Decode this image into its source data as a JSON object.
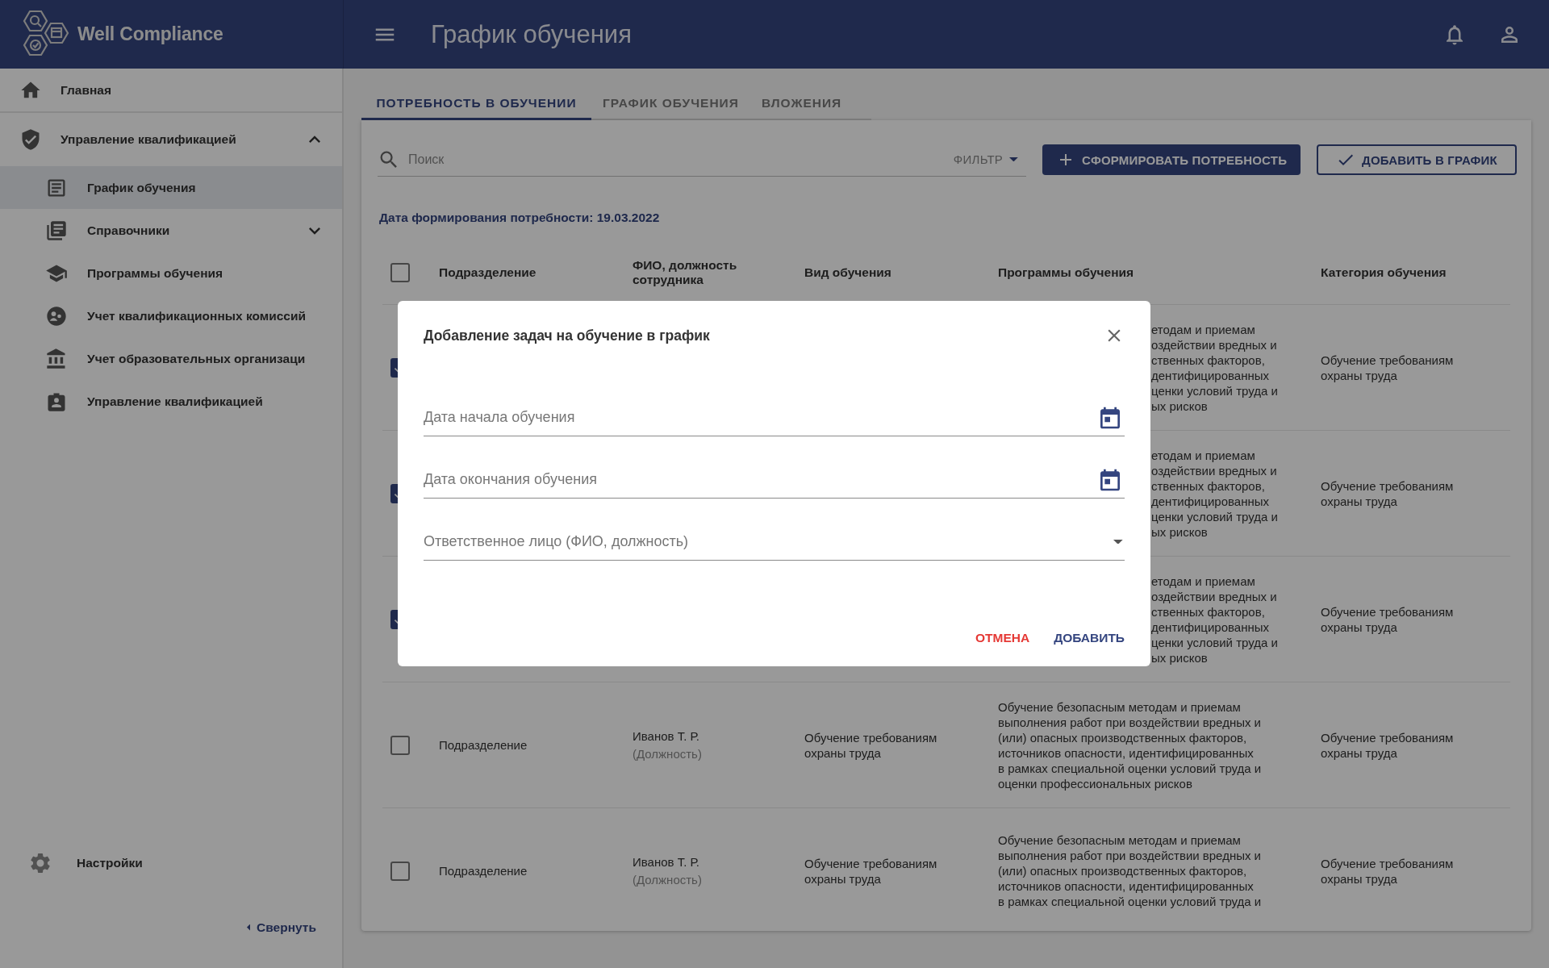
{
  "app": {
    "name": "Well Compliance"
  },
  "header": {
    "title": "График обучения"
  },
  "sidebar": {
    "items": [
      {
        "label": "Главная",
        "selected": false
      },
      {
        "label": "Управление квалификацией",
        "selected": false,
        "expanded": true,
        "children": [
          {
            "label": "График обучения",
            "selected": true
          },
          {
            "label": "Справочники",
            "selected": false,
            "expanded": false
          },
          {
            "label": "Программы обучения",
            "selected": false
          },
          {
            "label": "Учет квалификационных комиссий",
            "selected": false
          },
          {
            "label": "Учет образовательных организаци",
            "selected": false
          },
          {
            "label": "Управление квалификацией",
            "selected": false
          }
        ]
      }
    ],
    "settings": "Настройки",
    "collapse": "Свернуть"
  },
  "tabs": [
    {
      "label": "ПОТРЕБНОСТЬ В ОБУЧЕНИИ",
      "selected": true
    },
    {
      "label": "ГРАФИК ОБУЧЕНИЯ",
      "selected": false
    },
    {
      "label": "ВЛОЖЕНИЯ",
      "selected": false
    }
  ],
  "toolbar": {
    "search": {
      "placeholder": "Поиск"
    },
    "filter": "ФИЛЬТР",
    "buttons": [
      {
        "label": "СФОРМИРОВАТЬ ПОТРЕБНОСТЬ",
        "kind": "primary"
      },
      {
        "label": "ДОБАВИТЬ В ГРАФИК",
        "kind": "outlined"
      }
    ]
  },
  "need_date": "Дата формирования потребности: 19.03.2022",
  "table": {
    "all_checked": false,
    "columns": [
      "Подразделение",
      "ФИО, должность сотрудника",
      "Вид обучения",
      "Программы обучения",
      "Категория обучения"
    ],
    "rows": [
      {
        "kind": "covered",
        "checked": true,
        "program": "етодам и приемам\nоздействии вредных и\nственных факторов,\nдентифицированных\nценки условий труда и\nых рисков",
        "category": "Обучение требованиям\nохраны труда"
      },
      {
        "kind": "covered",
        "checked": true,
        "program": "етодам и приемам\nоздействии вредных и\nственных факторов,\nдентифицированных\nценки условий труда и\nых рисков",
        "category": "Обучение требованиям\nохраны труда"
      },
      {
        "kind": "covered",
        "checked": true,
        "program": "етодам и приемам\nоздействии вредных и\nственных факторов,\nдентифицированных\nценки условий труда и\nых рисков",
        "category": "Обучение требованиям\nохраны труда"
      },
      {
        "kind": "full",
        "checked": false,
        "department": "Подразделение",
        "employee": "Иванов Т. Р.",
        "position": "(Должность)",
        "training_type": "Обучение требованиям\nохраны труда",
        "program": "Обучение безопасным методам и приемам\nвыполнения работ при воздействии вредных и\n(или) опасных производственных факторов,\nисточников опасности, идентифицированных\nв рамках специальной оценки условий труда и\nоценки профессиональных рисков",
        "category": "Обучение требованиям\nохраны труда"
      },
      {
        "kind": "full",
        "checked": false,
        "department": "Подразделение",
        "employee": "Иванов Т. Р.",
        "position": "(Должность)",
        "training_type": "Обучение требованиям\nохраны труда",
        "program": "Обучение безопасным методам и приемам\nвыполнения работ при воздействии вредных и\n(или) опасных производственных факторов,\nисточников опасности, идентифицированных\nв рамках специальной оценки условий труда и",
        "category": "Обучение требованиям\nохраны труда"
      }
    ]
  },
  "dialog": {
    "title": "Добавление задач на обучение в график",
    "fields": [
      {
        "kind": "date",
        "placeholder": "Дата начала обучения"
      },
      {
        "kind": "date",
        "placeholder": "Дата окончания обучения"
      },
      {
        "kind": "select",
        "placeholder": "Ответственное лицо (ФИО, должность)"
      }
    ],
    "buttons": [
      {
        "label": "ОТМЕНА",
        "kind": "cancel"
      },
      {
        "label": "ДОБАВИТЬ",
        "kind": "confirm"
      }
    ]
  }
}
